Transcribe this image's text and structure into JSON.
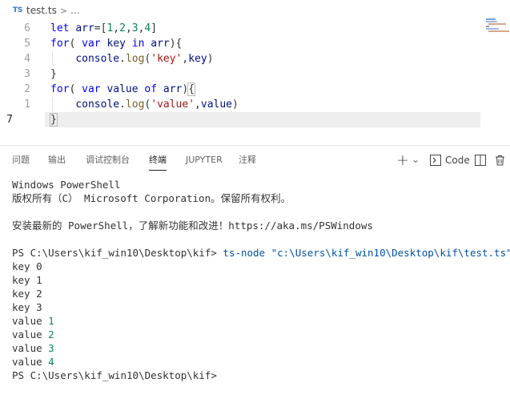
{
  "breadcrumb": {
    "lang_badge": "TS",
    "file": "test.ts",
    "separator": ">",
    "ellipsis": "..."
  },
  "editor": {
    "lines": [
      {
        "number": "6",
        "tokens": [
          [
            "kw",
            "let "
          ],
          [
            "var",
            "arr"
          ],
          [
            "punct",
            "=["
          ],
          [
            "num",
            "1"
          ],
          [
            "punct",
            ","
          ],
          [
            "num",
            "2"
          ],
          [
            "punct",
            ","
          ],
          [
            "num",
            "3"
          ],
          [
            "punct",
            ","
          ],
          [
            "num",
            "4"
          ],
          [
            "punct",
            "]"
          ]
        ]
      },
      {
        "number": "5",
        "tokens": [
          [
            "kw",
            "for"
          ],
          [
            "punct",
            "( "
          ],
          [
            "kw",
            "var "
          ],
          [
            "var",
            "key "
          ],
          [
            "kw",
            "in "
          ],
          [
            "var",
            "arr"
          ],
          [
            "punct",
            "){"
          ]
        ]
      },
      {
        "number": "4",
        "tokens": [
          [
            "punct",
            "    "
          ],
          [
            "var",
            "console"
          ],
          [
            "punct",
            "."
          ],
          [
            "fn",
            "log"
          ],
          [
            "punct",
            "("
          ],
          [
            "str",
            "'key'"
          ],
          [
            "punct",
            ","
          ],
          [
            "var",
            "key"
          ],
          [
            "punct",
            ")"
          ]
        ]
      },
      {
        "number": "3",
        "tokens": [
          [
            "punct",
            "}"
          ]
        ]
      },
      {
        "number": "2",
        "tokens": [
          [
            "kw",
            "for"
          ],
          [
            "punct",
            "( "
          ],
          [
            "kw",
            "var "
          ],
          [
            "var",
            "value "
          ],
          [
            "kw",
            "of "
          ],
          [
            "var",
            "arr"
          ],
          [
            "punct",
            ")"
          ],
          [
            "punct",
            "{"
          ]
        ]
      },
      {
        "number": "1",
        "tokens": [
          [
            "punct",
            "    "
          ],
          [
            "var",
            "console"
          ],
          [
            "punct",
            "."
          ],
          [
            "fn",
            "log"
          ],
          [
            "punct",
            "("
          ],
          [
            "str",
            "'value'"
          ],
          [
            "punct",
            ","
          ],
          [
            "var",
            "value"
          ],
          [
            "punct",
            ")"
          ]
        ]
      },
      {
        "number": "7",
        "tokens": [
          [
            "punct",
            "}"
          ]
        ]
      }
    ]
  },
  "panel": {
    "tabs": [
      "问题",
      "输出",
      "调试控制台",
      "终端",
      "JUPYTER",
      "注释"
    ],
    "active_tab": "终端",
    "toolbar": {
      "add_label": "+",
      "dropdown_label": "⌄",
      "code_label": "Code"
    }
  },
  "terminal": {
    "lines": [
      "Windows PowerShell",
      "版权所有（C） Microsoft Corporation。保留所有权利。",
      "",
      "安装最新的 PowerShell，了解新功能和改进！https://aka.ms/PSWindows",
      "",
      "PS C:\\Users\\kif_win10\\Desktop\\kif> ",
      "key 0",
      "key 1",
      "key 2",
      "key 3",
      "value 1",
      "value 2",
      "value 3",
      "value 4",
      "PS C:\\Users\\kif_win10\\Desktop\\kif>"
    ],
    "command": "ts-node \"c:\\Users\\kif_win10\\Desktop\\kif\\test.ts\""
  },
  "colors": {
    "keyword": "#0000ff",
    "variable": "#001080",
    "function": "#795e26",
    "string": "#a31515",
    "number": "#098658",
    "command": "#0451a5"
  }
}
